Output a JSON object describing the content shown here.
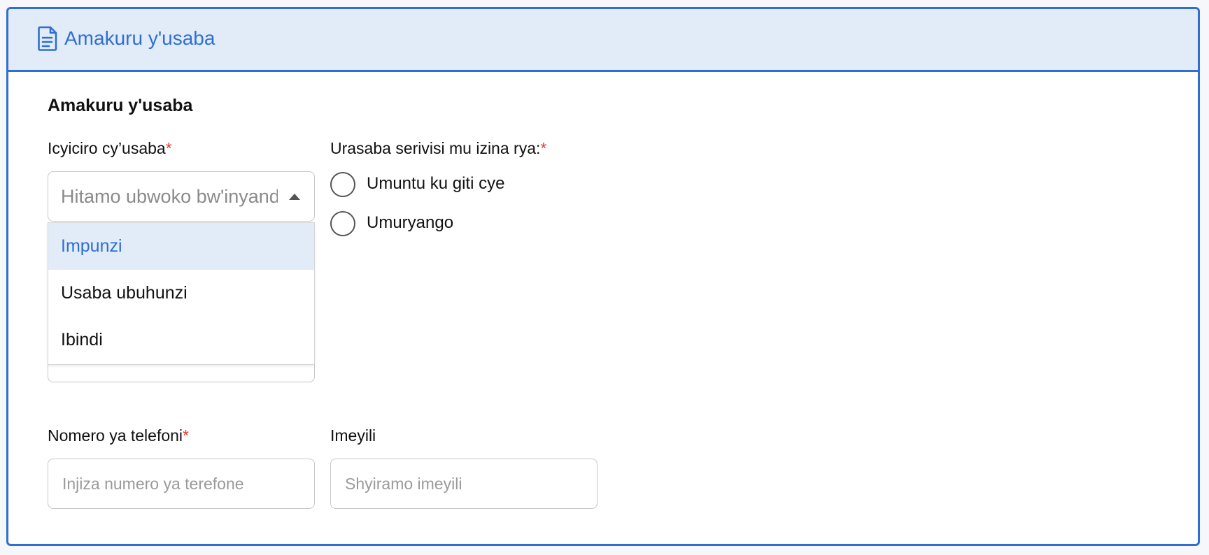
{
  "card": {
    "header_title": "Amakuru y'usaba",
    "header_icon": "document-icon",
    "accent_color": "#2f6fd1",
    "header_bg": "#e2ecf8"
  },
  "form": {
    "section_title": "Amakuru y'usaba",
    "category": {
      "label": "Icyiciro cy’usaba",
      "required_mark": "*",
      "placeholder": "Hitamo ubwoko bw'inyandiko",
      "options": [
        "Impunzi",
        "Usaba ubuhunzi",
        "Ibindi"
      ],
      "highlighted_option": "Impunzi"
    },
    "applicant_type": {
      "label": "Urasaba serivisi mu izina rya:",
      "required_mark": "*",
      "options": [
        "Umuntu ku giti cye",
        "Umuryango"
      ]
    },
    "phone": {
      "label": "Nomero ya telefoni",
      "required_mark": "*",
      "placeholder": "Injiza numero ya terefone"
    },
    "email": {
      "label": "Imeyili",
      "placeholder": "Shyiramo imeyili"
    }
  }
}
